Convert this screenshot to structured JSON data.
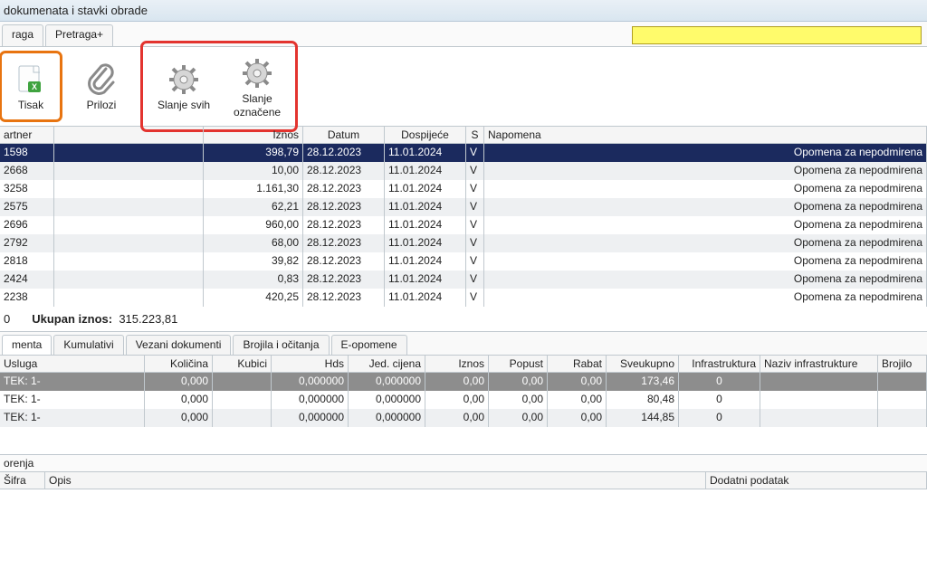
{
  "title": "dokumenata i stavki obrade",
  "top_tabs": {
    "t1": "raga",
    "t2": "Pretraga+"
  },
  "toolbar": {
    "tisak": "Tisak",
    "prilozi": "Prilozi",
    "slanje_svih": "Slanje svih",
    "slanje_oznacene": "Slanje\noznačene"
  },
  "main_headers": {
    "partner": "artner",
    "iznos": "Iznos",
    "datum": "Datum",
    "dospijece": "Dospijeće",
    "s": "S",
    "napomena": "Napomena"
  },
  "main_rows": [
    {
      "partner": "1598",
      "iznos": "398,79",
      "datum": "28.12.2023",
      "dosp": "11.01.2024",
      "s": "V",
      "nap": "Opomena za nepodmirena",
      "sel": true
    },
    {
      "partner": "2668",
      "iznos": "10,00",
      "datum": "28.12.2023",
      "dosp": "11.01.2024",
      "s": "V",
      "nap": "Opomena za nepodmirena"
    },
    {
      "partner": "3258",
      "iznos": "1.161,30",
      "datum": "28.12.2023",
      "dosp": "11.01.2024",
      "s": "V",
      "nap": "Opomena za nepodmirena"
    },
    {
      "partner": "2575",
      "iznos": "62,21",
      "datum": "28.12.2023",
      "dosp": "11.01.2024",
      "s": "V",
      "nap": "Opomena za nepodmirena"
    },
    {
      "partner": "2696",
      "iznos": "960,00",
      "datum": "28.12.2023",
      "dosp": "11.01.2024",
      "s": "V",
      "nap": "Opomena za nepodmirena"
    },
    {
      "partner": "2792",
      "iznos": "68,00",
      "datum": "28.12.2023",
      "dosp": "11.01.2024",
      "s": "V",
      "nap": "Opomena za nepodmirena"
    },
    {
      "partner": "2818",
      "iznos": "39,82",
      "datum": "28.12.2023",
      "dosp": "11.01.2024",
      "s": "V",
      "nap": "Opomena za nepodmirena"
    },
    {
      "partner": "2424",
      "iznos": "0,83",
      "datum": "28.12.2023",
      "dosp": "11.01.2024",
      "s": "V",
      "nap": "Opomena za nepodmirena"
    },
    {
      "partner": "2238",
      "iznos": "420,25",
      "datum": "28.12.2023",
      "dosp": "11.01.2024",
      "s": "V",
      "nap": "Opomena za nepodmirena"
    }
  ],
  "summary": {
    "left": "0",
    "ukupan_label": "Ukupan iznos:",
    "ukupan_val": "315.223,81"
  },
  "tabs2": {
    "t1": "menta",
    "t2": "Kumulativi",
    "t3": "Vezani dokumenti",
    "t4": "Brojila i očitanja",
    "t5": "E-opomene"
  },
  "detail_headers": {
    "usluga": "Usluga",
    "kolicina": "Količina",
    "kubici": "Kubici",
    "hds": "Hds",
    "jed": "Jed. cijena",
    "iznos": "Iznos",
    "popust": "Popust",
    "rabat": "Rabat",
    "sveukupno": "Sveukupno",
    "infra": "Infrastruktura",
    "naziv": "Naziv infrastrukture",
    "brojilo": "Brojilo"
  },
  "detail_rows": [
    {
      "usluga": "TEK: 1-",
      "kolicina": "0,000",
      "kubici": "",
      "hds": "0,000000",
      "jed": "0,000000",
      "iznos": "0,00",
      "popust": "0,00",
      "rabat": "0,00",
      "sve": "173,46",
      "infra": "0",
      "sel": true
    },
    {
      "usluga": "TEK: 1-",
      "kolicina": "0,000",
      "kubici": "",
      "hds": "0,000000",
      "jed": "0,000000",
      "iznos": "0,00",
      "popust": "0,00",
      "rabat": "0,00",
      "sve": "80,48",
      "infra": "0"
    },
    {
      "usluga": "TEK: 1-",
      "kolicina": "0,000",
      "kubici": "",
      "hds": "0,000000",
      "jed": "0,000000",
      "iznos": "0,00",
      "popust": "0,00",
      "rabat": "0,00",
      "sve": "144,85",
      "infra": "0"
    }
  ],
  "bottom": {
    "orenja": "orenja",
    "sifra": "Šifra",
    "opis": "Opis",
    "dodatni": "Dodatni podatak"
  }
}
